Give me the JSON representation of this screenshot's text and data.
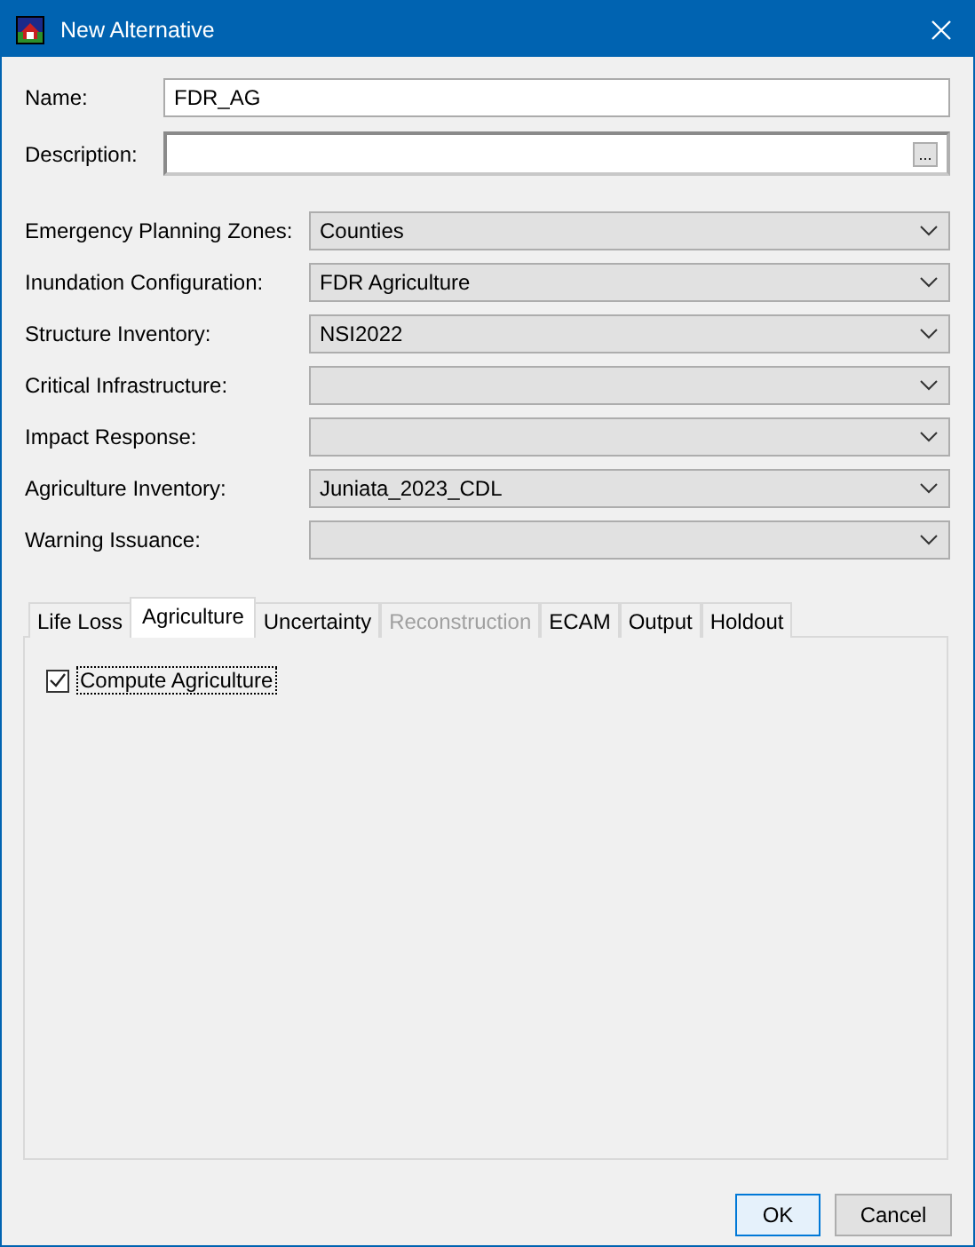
{
  "window": {
    "title": "New Alternative"
  },
  "name": {
    "label": "Name:",
    "value": "FDR_AG"
  },
  "description": {
    "label": "Description:",
    "button": "..."
  },
  "selectors": [
    {
      "label": "Emergency Planning Zones:",
      "value": "Counties"
    },
    {
      "label": "Inundation Configuration:",
      "value": "FDR Agriculture"
    },
    {
      "label": "Structure Inventory:",
      "value": "NSI2022"
    },
    {
      "label": "Critical Infrastructure:"
    },
    {
      "label": "Impact Response:"
    },
    {
      "label": "Agriculture Inventory:",
      "value": "Juniata_2023_CDL"
    },
    {
      "label": "Warning Issuance:"
    }
  ],
  "tabs": [
    {
      "label": "Life Loss",
      "selected": false,
      "disabled": false
    },
    {
      "label": "Agriculture",
      "selected": true,
      "disabled": false
    },
    {
      "label": "Uncertainty",
      "selected": false,
      "disabled": false
    },
    {
      "label": "Reconstruction",
      "selected": false,
      "disabled": true
    },
    {
      "label": "ECAM",
      "selected": false,
      "disabled": false
    },
    {
      "label": "Output",
      "selected": false,
      "disabled": false
    },
    {
      "label": "Holdout",
      "selected": false,
      "disabled": false
    }
  ],
  "panel": {
    "checkbox": {
      "label": "Compute Agriculture",
      "checked": true
    }
  },
  "buttons": [
    {
      "label": "OK",
      "default": true
    },
    {
      "label": "Cancel",
      "default": false
    }
  ]
}
